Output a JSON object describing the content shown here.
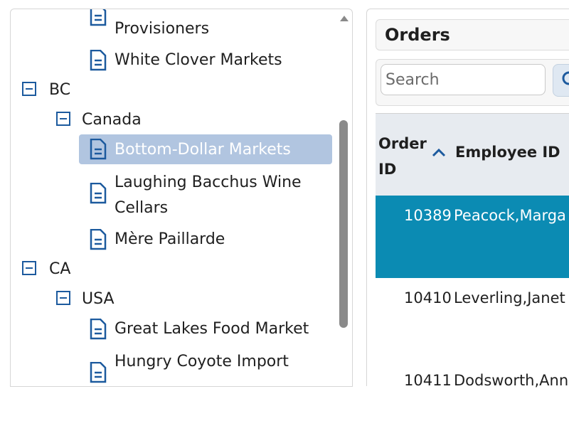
{
  "tree": {
    "items": [
      {
        "type": "leaf",
        "label": "Provisioners"
      },
      {
        "type": "leaf",
        "label": "White Clover Markets"
      },
      {
        "type": "group",
        "label": "BC"
      },
      {
        "type": "group",
        "label": "Canada"
      },
      {
        "type": "leaf",
        "label": "Bottom-Dollar Markets",
        "selected": true
      },
      {
        "type": "leaf",
        "label_line1": "Laughing Bacchus Wine",
        "label_line2": "Cellars"
      },
      {
        "type": "leaf",
        "label": "Mère Paillarde"
      },
      {
        "type": "group",
        "label": "CA"
      },
      {
        "type": "group",
        "label": "USA"
      },
      {
        "type": "leaf",
        "label": "Great Lakes Food Market"
      },
      {
        "type": "leaf",
        "label": "Hungry Coyote Import"
      }
    ],
    "icon_color": "#1c5a9e",
    "selected_color": "#b1c5e0"
  },
  "orders": {
    "title": "Orders",
    "search_placeholder": "Search",
    "columns": {
      "order_id_line1": "Order",
      "order_id_line2": "ID",
      "employee_id": "Employee ID"
    },
    "rows": [
      {
        "order_id": "10389",
        "employee": "Peacock,Marga",
        "selected": true
      },
      {
        "order_id": "10410",
        "employee": "Leverling,Janet"
      },
      {
        "order_id": "10411",
        "employee": "Dodsworth,Ann"
      }
    ],
    "accent_color": "#0b8bb3"
  }
}
